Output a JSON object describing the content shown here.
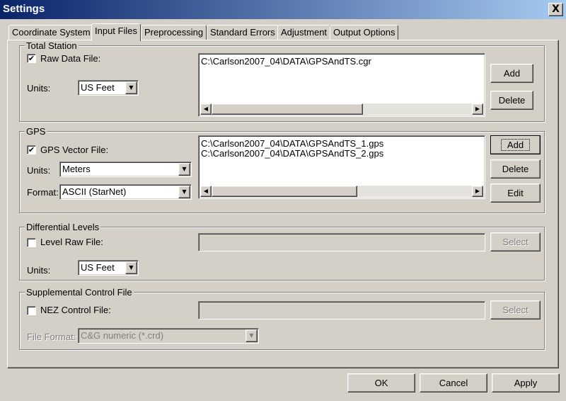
{
  "window": {
    "title": "Settings",
    "close_label": "X"
  },
  "tabs": [
    {
      "label": "Coordinate System"
    },
    {
      "label": "Input Files"
    },
    {
      "label": "Preprocessing"
    },
    {
      "label": "Standard Errors"
    },
    {
      "label": "Adjustment"
    },
    {
      "label": "Output Options"
    }
  ],
  "active_tab": "Input Files",
  "total_station": {
    "legend": "Total Station",
    "checkbox_label": "Raw Data File:",
    "checked": true,
    "units_label": "Units:",
    "units_value": "US Feet",
    "files": [
      "C:\\Carlson2007_04\\DATA\\GPSAndTS.cgr"
    ],
    "add_label": "Add",
    "delete_label": "Delete"
  },
  "gps": {
    "legend": "GPS",
    "checkbox_label": "GPS Vector File:",
    "checked": true,
    "units_label": "Units:",
    "units_value": "Meters",
    "format_label": "Format:",
    "format_value": "ASCII (StarNet)",
    "files": [
      "C:\\Carlson2007_04\\DATA\\GPSAndTS_1.gps",
      "C:\\Carlson2007_04\\DATA\\GPSAndTS_2.gps"
    ],
    "add_label": "Add",
    "delete_label": "Delete",
    "edit_label": "Edit"
  },
  "differential_levels": {
    "legend": "Differential Levels",
    "checkbox_label": "Level Raw File:",
    "checked": false,
    "file_value": "",
    "select_label": "Select",
    "units_label": "Units:",
    "units_value": "US Feet"
  },
  "supplemental_control": {
    "legend": "Supplemental Control File",
    "checkbox_label": "NEZ Control File:",
    "checked": false,
    "file_value": "",
    "select_label": "Select",
    "file_format_label": "File Format:",
    "file_format_value": "C&G numeric (*.crd)"
  },
  "footer": {
    "ok_label": "OK",
    "cancel_label": "Cancel",
    "apply_label": "Apply"
  },
  "colors": {
    "title_start": "#0a246a",
    "title_end": "#a6caf0",
    "face": "#d4d0c8",
    "disabled_text": "#808080"
  },
  "icons": {
    "check": "✔",
    "arrow_down": "▼",
    "arrow_left": "◀",
    "arrow_right": "▶"
  }
}
